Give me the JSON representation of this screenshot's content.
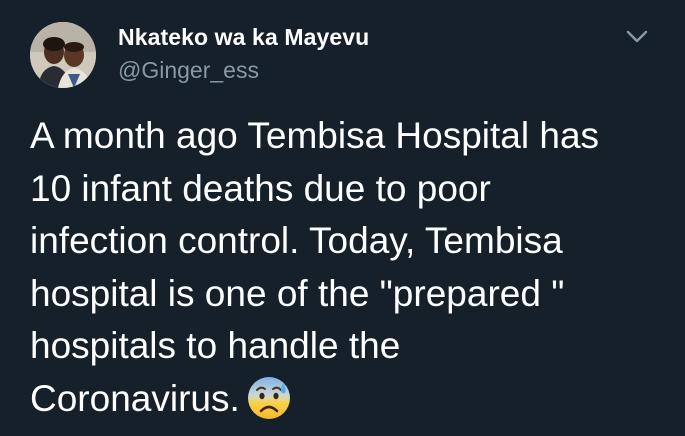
{
  "tweet": {
    "author": {
      "display_name": "Nkateko wa ka Mayevu",
      "handle": "@Ginger_ess"
    },
    "body": "A month ago Tembisa Hospital has\n10 infant deaths due to poor\ninfection control. Today, Tembisa\nhospital is one of the \"prepared \"\nhospitals to handle the\nCoronavirus.",
    "emoji": "anxious-face-with-sweat-icon",
    "more_icon": "chevron-down-icon"
  },
  "colors": {
    "background": "#15202b",
    "text_primary": "#ffffff",
    "text_secondary": "#8899a6"
  }
}
